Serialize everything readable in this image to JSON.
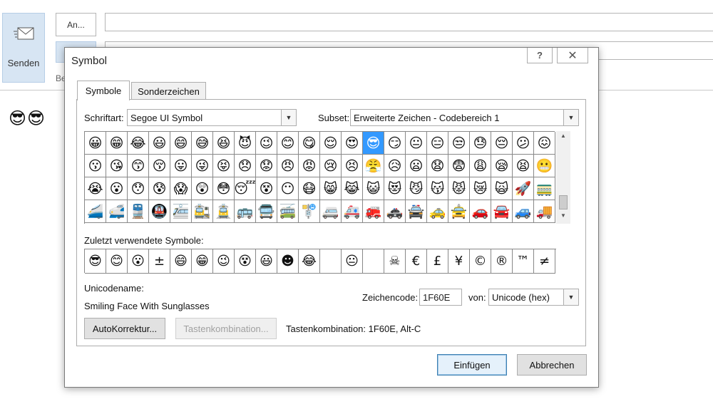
{
  "mail": {
    "send_label": "Senden",
    "to_label": "An...",
    "subject_label": "Be",
    "body_text": "😎😎"
  },
  "dialog": {
    "title": "Symbol",
    "help_glyph": "?",
    "close_glyph": "✕",
    "tabs": [
      {
        "label": "Symbole",
        "active": true
      },
      {
        "label": "Sonderzeichen",
        "active": false
      }
    ],
    "font_label": "Schriftart:",
    "font_value": "Segoe UI Symbol",
    "subset_label": "Subset:",
    "subset_value": "Erweiterte Zeichen - Codebereich 1",
    "symbols": [
      "😀",
      "😁",
      "😂",
      "😃",
      "😄",
      "😅",
      "😆",
      "😈",
      "😉",
      "😊",
      "😋",
      "😌",
      "😍",
      "😎",
      "😏",
      "😐",
      "😑",
      "😒",
      "😓",
      "😔",
      "😕",
      "😖",
      "😗",
      "😘",
      "😙",
      "😚",
      "😛",
      "😜",
      "😝",
      "😞",
      "😟",
      "😠",
      "😡",
      "😢",
      "😣",
      "😤",
      "😥",
      "😦",
      "😧",
      "😨",
      "😩",
      "😪",
      "😫",
      "😬",
      "😭",
      "😮",
      "😯",
      "😰",
      "😱",
      "😲",
      "😳",
      "😴",
      "😵",
      "😶",
      "😷",
      "😸",
      "😹",
      "😺",
      "😻",
      "😼",
      "😽",
      "😾",
      "😿",
      "🙀",
      "🚀",
      "🚃",
      "🚄",
      "🚅",
      "🚆",
      "🚇",
      "🚈",
      "🚉",
      "🚊",
      "🚌",
      "🚍",
      "🚎",
      "🚏",
      "🚐",
      "🚑",
      "🚒",
      "🚓",
      "🚔",
      "🚕",
      "🚖",
      "🚗",
      "🚘",
      "🚙",
      "🚚"
    ],
    "selected_index": 13,
    "recent_label": "Zuletzt verwendete Symbole:",
    "recent_symbols": [
      "😎",
      "😊",
      "😮",
      "±",
      "😄",
      "😁",
      "😉",
      "😵",
      "😃",
      "☻",
      "😂",
      "",
      "😐",
      "",
      "☠",
      "€",
      "£",
      "¥",
      "©",
      "®",
      "™",
      "≠"
    ],
    "unicode_name_label": "Unicodename:",
    "unicode_name_value": "Smiling Face With Sunglasses",
    "code_label": "Zeichencode:",
    "code_value": "1F60E",
    "from_label": "von:",
    "from_value": "Unicode (hex)",
    "autocorrect_button": "AutoKorrektur...",
    "shortcut_button": "Tastenkombination...",
    "shortcut_text": "Tastenkombination: 1F60E, Alt-C",
    "insert_button": "Einfügen",
    "cancel_button": "Abbrechen"
  }
}
